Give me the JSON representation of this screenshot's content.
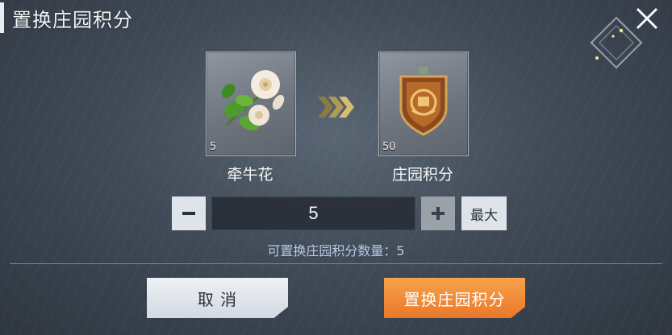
{
  "dialog": {
    "title": "置换庄园积分"
  },
  "source_item": {
    "name": "牵牛花",
    "count": "5",
    "icon": "morning-glory-flower-icon"
  },
  "target_item": {
    "name": "庄园积分",
    "count": "50",
    "icon": "manor-points-badge-icon"
  },
  "quantity": {
    "value": "5",
    "max_label": "最大",
    "minus_symbol": "−",
    "plus_symbol": "+"
  },
  "hint": {
    "text": "可置换庄园积分数量：5"
  },
  "buttons": {
    "cancel_label": "取 消",
    "confirm_label": "置换庄园积分"
  },
  "colors": {
    "confirm": "#f08b34",
    "cancel": "#e3e8ee",
    "hint": "#b7c9e4"
  }
}
